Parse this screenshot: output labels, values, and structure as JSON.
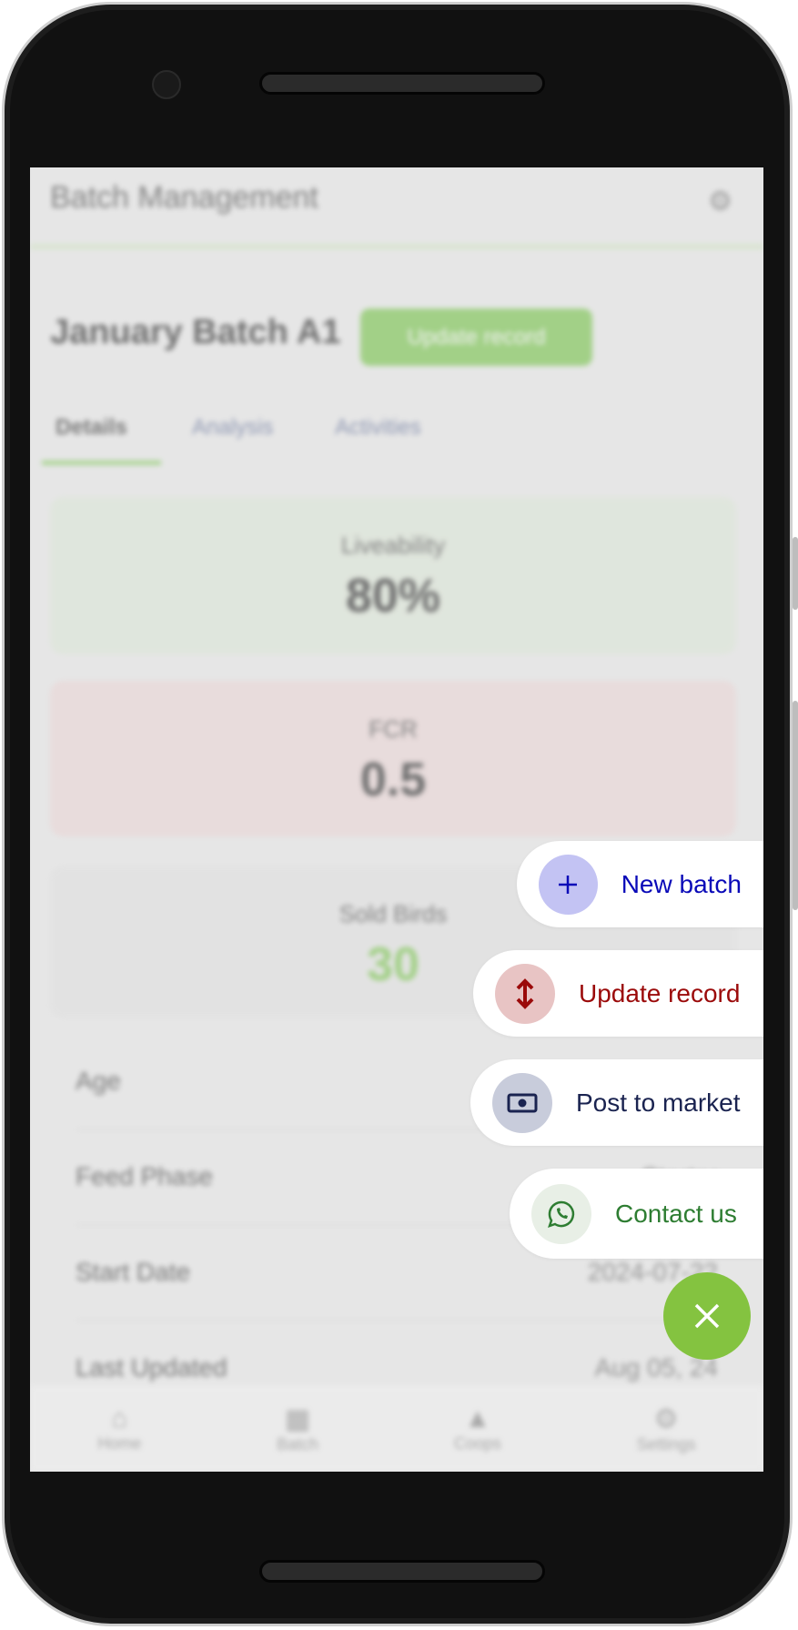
{
  "app": {
    "header_title": "Batch Management",
    "batch_title": "January Batch A1",
    "update_button": "Update record",
    "tabs": [
      {
        "label": "Details"
      },
      {
        "label": "Analysis"
      },
      {
        "label": "Activities"
      }
    ],
    "cards": [
      {
        "label": "Liveability",
        "value": "80%",
        "bg": "#dbe6d6"
      },
      {
        "label": "FCR",
        "value": "0.5",
        "bg": "#ead4d4"
      },
      {
        "label": "Sold Birds",
        "value": "30",
        "bg": "#e0e0e0",
        "value_color": "#6bbf3a"
      }
    ],
    "rows": [
      {
        "label": "Age",
        "value": ""
      },
      {
        "label": "Feed Phase",
        "value": "Starter"
      },
      {
        "label": "Start Date",
        "value": "2024-07-22"
      },
      {
        "label": "Last Updated",
        "value": "Aug 05, 24"
      }
    ],
    "bottom_nav": [
      {
        "label": "Home",
        "icon": "home-icon"
      },
      {
        "label": "Batch",
        "icon": "batch-icon",
        "active": true
      },
      {
        "label": "Coops",
        "icon": "coop-icon"
      },
      {
        "label": "Settings",
        "icon": "settings-icon"
      }
    ]
  },
  "fab_menu": {
    "items": [
      {
        "label": "New batch",
        "icon": "plus-icon",
        "color": "#0a0ab8",
        "icon_bg": "#c3c3f3"
      },
      {
        "label": "Update record",
        "icon": "up-down-arrow-icon",
        "color": "#9b0a0a",
        "icon_bg": "#e8c4c4"
      },
      {
        "label": "Post to market",
        "icon": "money-icon",
        "color": "#1a2350",
        "icon_bg": "#c8ccdb"
      },
      {
        "label": "Contact us",
        "icon": "whatsapp-icon",
        "color": "#2e7d32",
        "icon_bg": "#e8efe6"
      }
    ],
    "close_icon": "close-icon",
    "fab_color": "#84c340"
  }
}
